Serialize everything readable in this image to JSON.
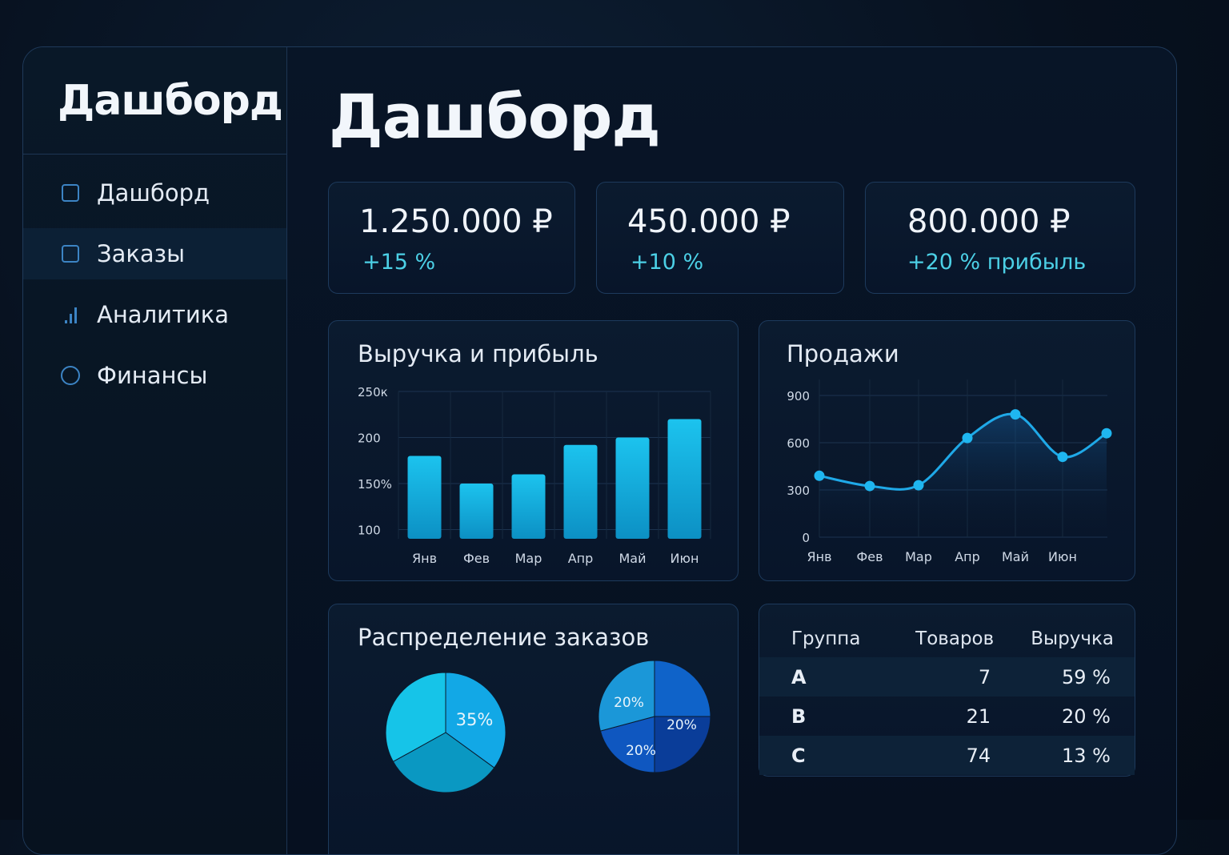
{
  "sidebar": {
    "title": "Дашборд",
    "items": [
      {
        "label": "Дашборд",
        "icon": "square-icon"
      },
      {
        "label": "Заказы",
        "icon": "square-icon",
        "active": true
      },
      {
        "label": "Аналитика",
        "icon": "bar-chart-icon"
      },
      {
        "label": "Финансы",
        "icon": "circle-icon"
      }
    ]
  },
  "main": {
    "title": "Дашборд",
    "kpis": [
      {
        "value": "1.250.000 ₽",
        "delta": "+15 %"
      },
      {
        "value": "450.000 ₽",
        "delta": "+10 %"
      },
      {
        "value": "800.000 ₽",
        "delta": "+20 % прибыль"
      }
    ],
    "revenue_card": {
      "title": "Выручка и прибыль"
    },
    "sales_card": {
      "title": "Продажи"
    },
    "distribution_card": {
      "title": "Распределение заказов"
    },
    "table": {
      "headers": [
        "Группа",
        "Товаров",
        "Выручка"
      ],
      "rows": [
        [
          "A",
          "7",
          "59 %"
        ],
        [
          "B",
          "21",
          "20 %"
        ],
        [
          "C",
          "74",
          "13 %"
        ]
      ]
    }
  },
  "colors": {
    "accent": "#1fb6e6",
    "delta": "#4cd0e6",
    "background": "#07111f"
  },
  "chart_data": [
    {
      "type": "bar",
      "title": "Выручка и прибыль",
      "categories": [
        "Янв",
        "Фев",
        "Мар",
        "Апр",
        "Май",
        "Июн"
      ],
      "values": [
        180,
        150,
        160,
        192,
        200,
        220
      ],
      "ytick_labels": [
        "250к",
        "200",
        "150%",
        "100"
      ],
      "ylim": [
        90,
        250
      ],
      "grid": true
    },
    {
      "type": "line",
      "title": "Продажи",
      "categories": [
        "Янв",
        "Фев",
        "Мар",
        "Апр",
        "Май",
        "Июн"
      ],
      "x": [
        0,
        1,
        2,
        3,
        4,
        5,
        6
      ],
      "values": [
        390,
        325,
        330,
        630,
        780,
        510,
        660
      ],
      "ytick_labels": [
        "900",
        "600",
        "300",
        "0"
      ],
      "ylim": [
        0,
        900
      ],
      "grid": true
    },
    {
      "type": "pie",
      "labels": [
        "35%"
      ],
      "values": [
        35,
        32,
        33
      ],
      "colors": [
        "#12a8e6",
        "#0a98c2",
        "#16c4e8"
      ]
    },
    {
      "type": "pie",
      "labels": [
        "20%",
        "20%",
        "20%"
      ],
      "values": [
        25,
        25,
        25,
        25
      ],
      "colors": [
        "#0f63c9",
        "#0a3d99",
        "#0f57c0",
        "#1b97d8"
      ]
    }
  ]
}
